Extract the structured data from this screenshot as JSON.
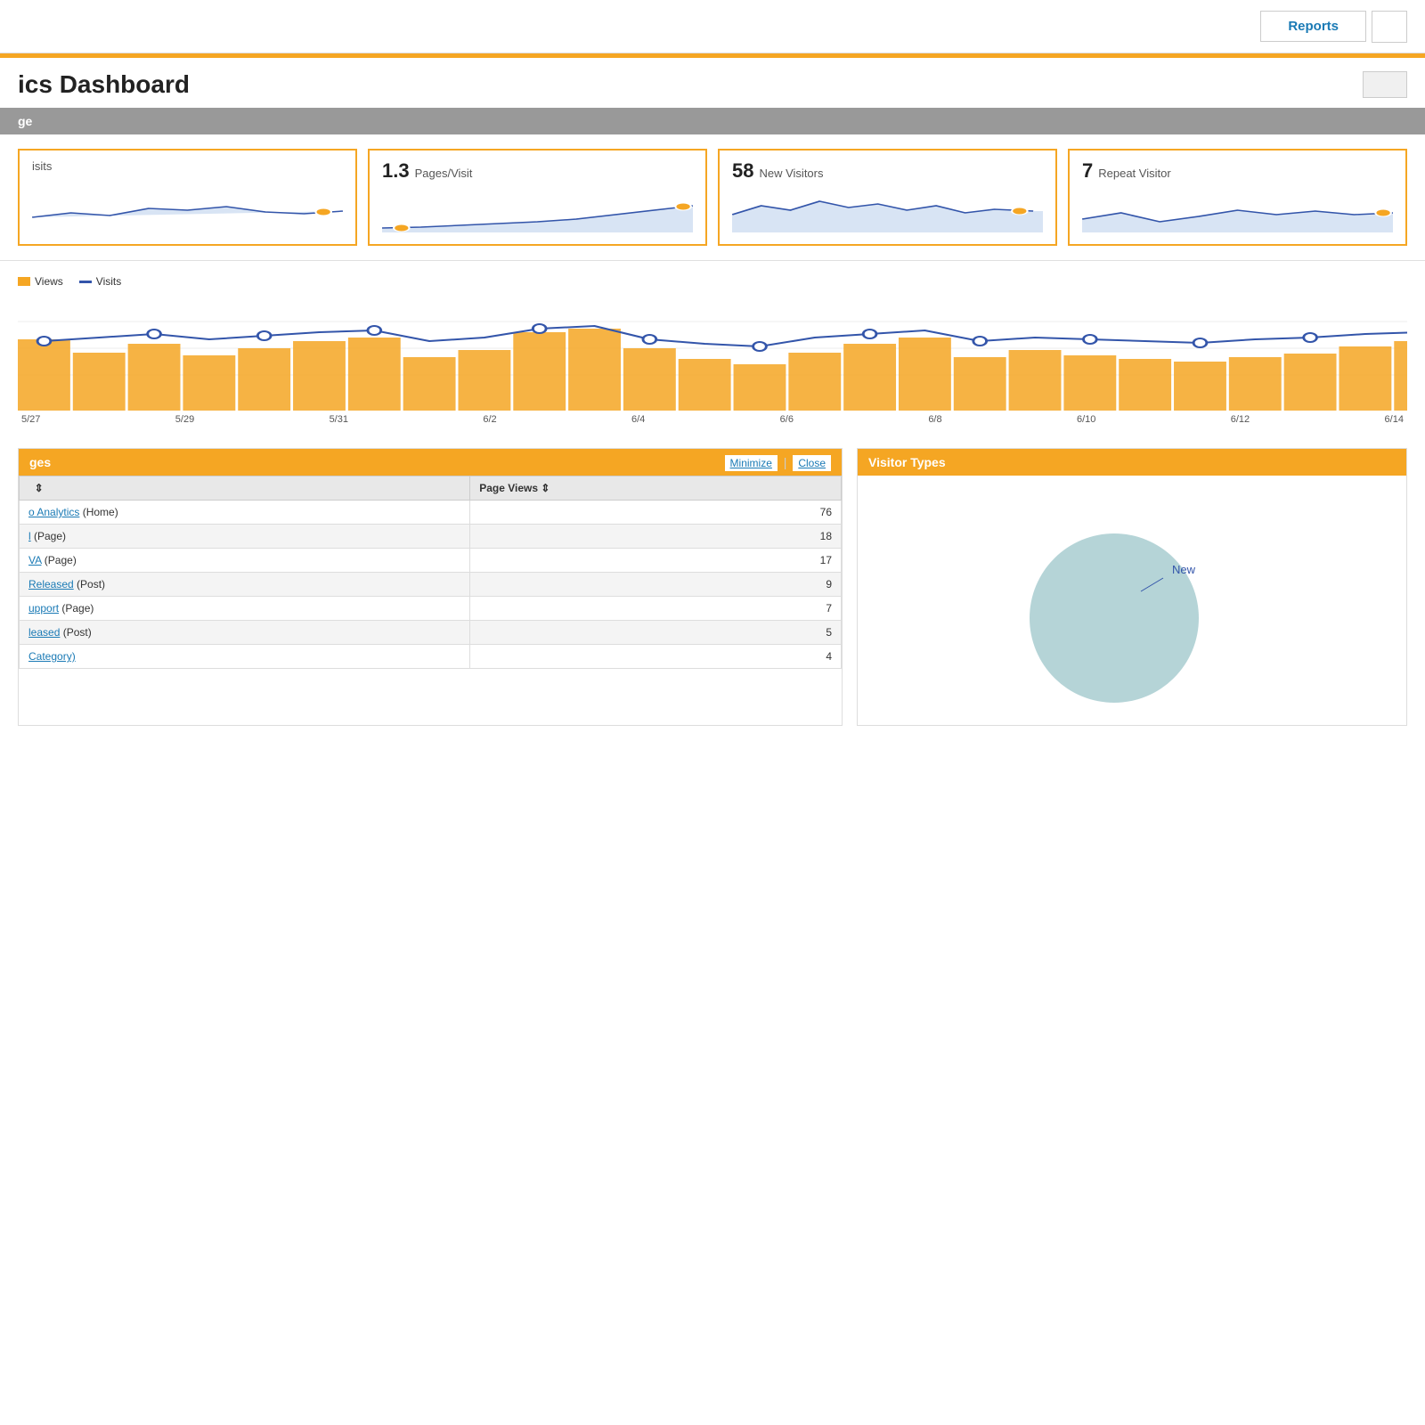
{
  "nav": {
    "reports_label": "Reports"
  },
  "page": {
    "title": "ics Dashboard",
    "section_label": "ge"
  },
  "stat_cards": [
    {
      "id": "visits",
      "label": "isits",
      "value": "",
      "unit": "",
      "has_chart": true
    },
    {
      "id": "pages_per_visit",
      "label": "Pages/Visit",
      "value": "1.3",
      "unit": "Pages/Visit",
      "has_chart": true
    },
    {
      "id": "new_visitors",
      "label": "New Visitors",
      "value": "58",
      "unit": "New Visitors",
      "has_chart": true
    },
    {
      "id": "repeat_visitors",
      "label": "Repeat Visitor",
      "value": "7",
      "unit": "Repeat Visitor",
      "has_chart": true
    }
  ],
  "chart": {
    "legend_views": "Views",
    "legend_visits": "Visits",
    "dates": [
      "5/27",
      "5/29",
      "5/31",
      "6/2",
      "6/4",
      "6/6",
      "6/8",
      "6/10",
      "6/12",
      "6/14"
    ]
  },
  "pages_panel": {
    "title": "ges",
    "minimize_label": "Minimize",
    "close_label": "Close",
    "col_page": "",
    "col_views": "Page Views",
    "rows": [
      {
        "page_text": "o Analytics",
        "page_suffix": "(Home)",
        "views": "76"
      },
      {
        "page_text": "l",
        "page_suffix": "(Page)",
        "views": "18"
      },
      {
        "page_text": "VA",
        "page_suffix": "(Page)",
        "views": "17"
      },
      {
        "page_text": "Released",
        "page_suffix": "(Post)",
        "views": "9"
      },
      {
        "page_text": "upport",
        "page_suffix": "(Page)",
        "views": "7"
      },
      {
        "page_text": "leased",
        "page_suffix": "(Post)",
        "views": "5"
      },
      {
        "page_text": "Category)",
        "page_suffix": "",
        "views": "4"
      }
    ]
  },
  "visitor_panel": {
    "title": "Visitor Types",
    "label_new": "New"
  }
}
